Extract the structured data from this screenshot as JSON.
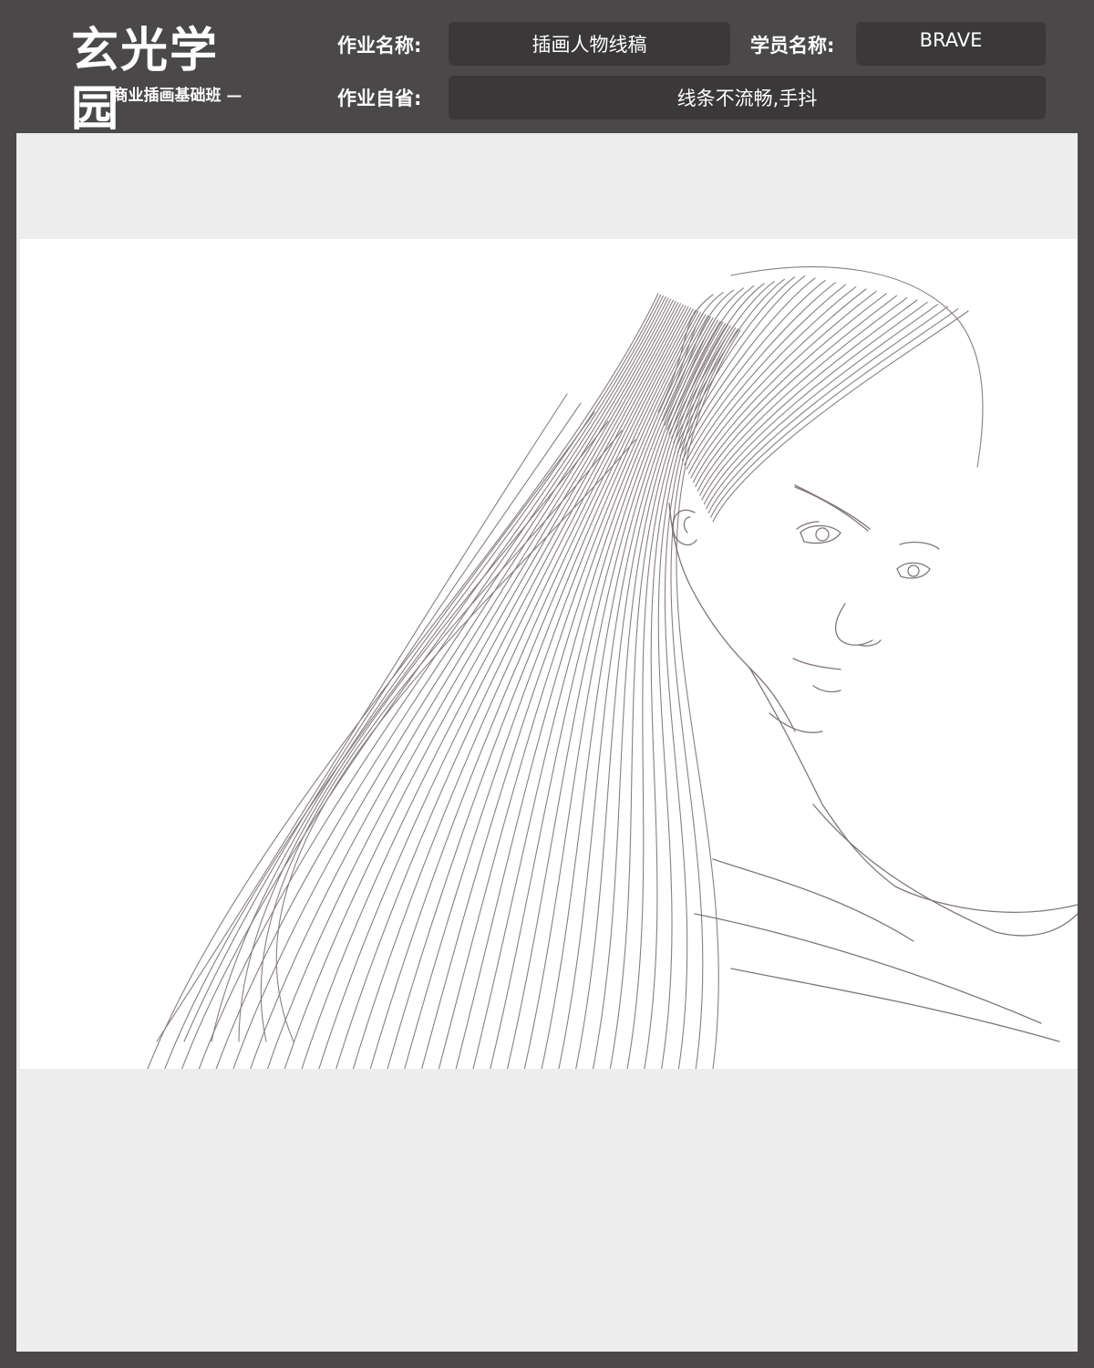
{
  "logo": {
    "title": "玄光学园",
    "subtitle": "— 商业插画基础班 —"
  },
  "form": {
    "assignment_name_label": "作业名称:",
    "assignment_name_value": "插画人物线稿",
    "student_name_label": "学员名称:",
    "student_name_value": "BRAVE",
    "self_review_label": "作业自省:",
    "self_review_value": "线条不流畅,手抖"
  },
  "colors": {
    "frame": "#4a4849",
    "field_bg": "#3a3839",
    "canvas_bg": "#ededed",
    "sketch_line": "#6b5f62"
  },
  "artwork": {
    "subject": "pencil line sketch of a woman with long flowing hair"
  }
}
